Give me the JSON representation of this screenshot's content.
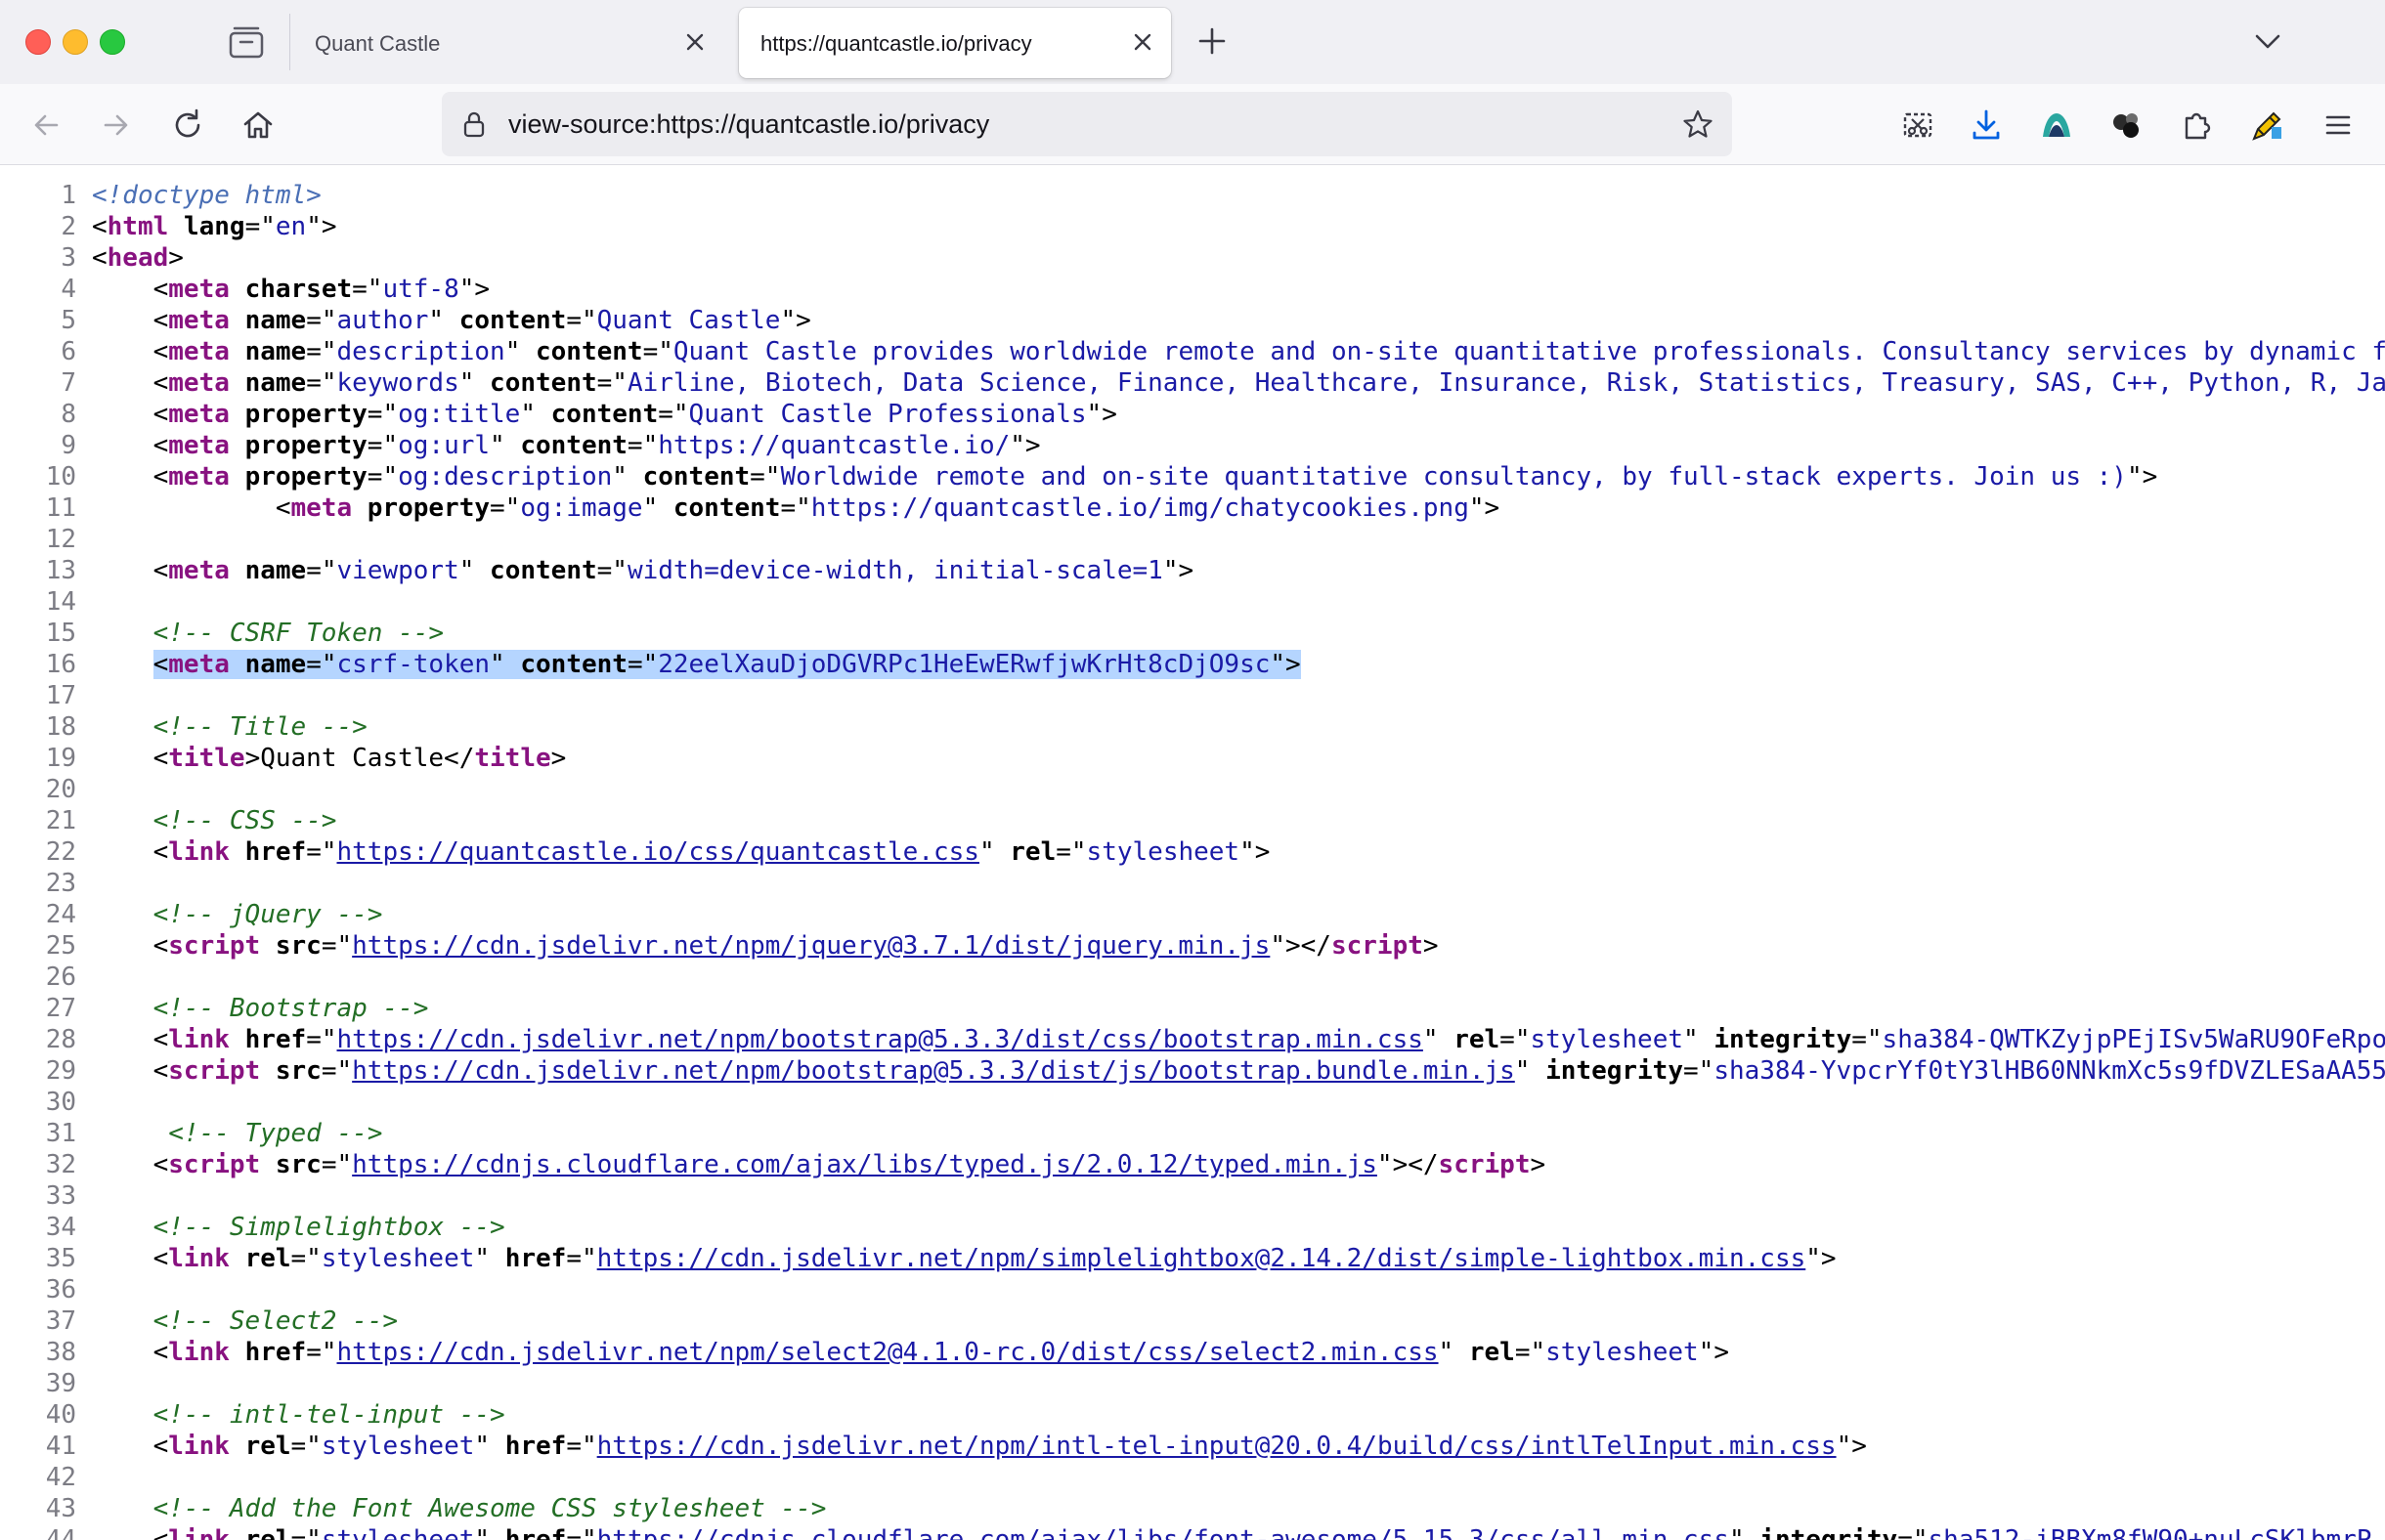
{
  "window": {
    "tabs": [
      {
        "title": "Quant Castle",
        "active": false
      },
      {
        "title": "https://quantcastle.io/privacy",
        "active": true
      }
    ]
  },
  "navbar": {
    "url": "view-source:https://quantcastle.io/privacy"
  },
  "icons": {
    "close": "close-icon",
    "new_tab": "plus-icon",
    "tab_list": "chevron-down-icon",
    "back": "back-arrow-icon",
    "forward": "forward-arrow-icon",
    "reload": "reload-icon",
    "home": "home-icon",
    "lock": "lock-icon",
    "bookmark": "star-icon",
    "screenshot": "screenshot-icon",
    "downloads": "download-icon",
    "extension_1": "extension-logo-icon",
    "extension_2": "extension-dots-icon",
    "extensions": "puzzle-icon",
    "extension_3": "pencil-extension-icon",
    "menu": "hamburger-menu-icon"
  },
  "source": {
    "lines": [
      {
        "n": "1",
        "tokens": [
          [
            "dt",
            "<!doctype html>"
          ]
        ]
      },
      {
        "n": "2",
        "tokens": [
          [
            "p",
            "<"
          ],
          [
            "tag",
            "html"
          ],
          [
            "p",
            " "
          ],
          [
            "an",
            "lang"
          ],
          [
            "p",
            "=\""
          ],
          [
            "av",
            "en"
          ],
          [
            "p",
            "\">"
          ]
        ]
      },
      {
        "n": "3",
        "tokens": [
          [
            "p",
            "<"
          ],
          [
            "tag",
            "head"
          ],
          [
            "p",
            ">"
          ]
        ]
      },
      {
        "n": "4",
        "tokens": [
          [
            "p",
            "    <"
          ],
          [
            "tag",
            "meta"
          ],
          [
            "p",
            " "
          ],
          [
            "an",
            "charset"
          ],
          [
            "p",
            "=\""
          ],
          [
            "av",
            "utf-8"
          ],
          [
            "p",
            "\">"
          ]
        ]
      },
      {
        "n": "5",
        "tokens": [
          [
            "p",
            "    <"
          ],
          [
            "tag",
            "meta"
          ],
          [
            "p",
            " "
          ],
          [
            "an",
            "name"
          ],
          [
            "p",
            "=\""
          ],
          [
            "av",
            "author"
          ],
          [
            "p",
            "\" "
          ],
          [
            "an",
            "content"
          ],
          [
            "p",
            "=\""
          ],
          [
            "av",
            "Quant Castle"
          ],
          [
            "p",
            "\">"
          ]
        ]
      },
      {
        "n": "6",
        "tokens": [
          [
            "p",
            "    <"
          ],
          [
            "tag",
            "meta"
          ],
          [
            "p",
            " "
          ],
          [
            "an",
            "name"
          ],
          [
            "p",
            "=\""
          ],
          [
            "av",
            "description"
          ],
          [
            "p",
            "\" "
          ],
          [
            "an",
            "content"
          ],
          [
            "p",
            "=\""
          ],
          [
            "av",
            "Quant Castle provides worldwide remote and on-site quantitative professionals. Consultancy services by dynamic f"
          ]
        ]
      },
      {
        "n": "7",
        "tokens": [
          [
            "p",
            "    <"
          ],
          [
            "tag",
            "meta"
          ],
          [
            "p",
            " "
          ],
          [
            "an",
            "name"
          ],
          [
            "p",
            "=\""
          ],
          [
            "av",
            "keywords"
          ],
          [
            "p",
            "\" "
          ],
          [
            "an",
            "content"
          ],
          [
            "p",
            "=\""
          ],
          [
            "av",
            "Airline, Biotech, Data Science, Finance, Healthcare, Insurance, Risk, Statistics, Treasury, SAS, C++, Python, R, Ja"
          ]
        ]
      },
      {
        "n": "8",
        "tokens": [
          [
            "p",
            "    <"
          ],
          [
            "tag",
            "meta"
          ],
          [
            "p",
            " "
          ],
          [
            "an",
            "property"
          ],
          [
            "p",
            "=\""
          ],
          [
            "av",
            "og:title"
          ],
          [
            "p",
            "\" "
          ],
          [
            "an",
            "content"
          ],
          [
            "p",
            "=\""
          ],
          [
            "av",
            "Quant Castle Professionals"
          ],
          [
            "p",
            "\">"
          ]
        ]
      },
      {
        "n": "9",
        "tokens": [
          [
            "p",
            "    <"
          ],
          [
            "tag",
            "meta"
          ],
          [
            "p",
            " "
          ],
          [
            "an",
            "property"
          ],
          [
            "p",
            "=\""
          ],
          [
            "av",
            "og:url"
          ],
          [
            "p",
            "\" "
          ],
          [
            "an",
            "content"
          ],
          [
            "p",
            "=\""
          ],
          [
            "av",
            "https://quantcastle.io/"
          ],
          [
            "p",
            "\">"
          ]
        ]
      },
      {
        "n": "10",
        "tokens": [
          [
            "p",
            "    <"
          ],
          [
            "tag",
            "meta"
          ],
          [
            "p",
            " "
          ],
          [
            "an",
            "property"
          ],
          [
            "p",
            "=\""
          ],
          [
            "av",
            "og:description"
          ],
          [
            "p",
            "\" "
          ],
          [
            "an",
            "content"
          ],
          [
            "p",
            "=\""
          ],
          [
            "av",
            "Worldwide remote and on-site quantitative consultancy, by full-stack experts. Join us :)"
          ],
          [
            "p",
            "\">"
          ]
        ]
      },
      {
        "n": "11",
        "tokens": [
          [
            "p",
            "            <"
          ],
          [
            "tag",
            "meta"
          ],
          [
            "p",
            " "
          ],
          [
            "an",
            "property"
          ],
          [
            "p",
            "=\""
          ],
          [
            "av",
            "og:image"
          ],
          [
            "p",
            "\" "
          ],
          [
            "an",
            "content"
          ],
          [
            "p",
            "=\""
          ],
          [
            "av",
            "https://quantcastle.io/img/chatycookies.png"
          ],
          [
            "p",
            "\">"
          ]
        ]
      },
      {
        "n": "12",
        "tokens": []
      },
      {
        "n": "13",
        "tokens": [
          [
            "p",
            "    <"
          ],
          [
            "tag",
            "meta"
          ],
          [
            "p",
            " "
          ],
          [
            "an",
            "name"
          ],
          [
            "p",
            "=\""
          ],
          [
            "av",
            "viewport"
          ],
          [
            "p",
            "\" "
          ],
          [
            "an",
            "content"
          ],
          [
            "p",
            "=\""
          ],
          [
            "av",
            "width=device-width, initial-scale=1"
          ],
          [
            "p",
            "\">"
          ]
        ]
      },
      {
        "n": "14",
        "tokens": []
      },
      {
        "n": "15",
        "tokens": [
          [
            "p",
            "    "
          ],
          [
            "cm",
            "<!-- CSRF Token -->"
          ]
        ]
      },
      {
        "n": "16",
        "selected": true,
        "tokens": [
          [
            "p",
            "    "
          ],
          [
            "sp",
            "<"
          ],
          [
            "stag",
            "meta"
          ],
          [
            "sp",
            " "
          ],
          [
            "san",
            "name"
          ],
          [
            "sp",
            "=\""
          ],
          [
            "sav",
            "csrf-token"
          ],
          [
            "sp",
            "\" "
          ],
          [
            "san",
            "content"
          ],
          [
            "sp",
            "=\""
          ],
          [
            "sav",
            "22eelXauDjoDGVRPc1HeEwERwfjwKrHt8cDjO9sc"
          ],
          [
            "sp",
            "\">"
          ]
        ]
      },
      {
        "n": "17",
        "tokens": []
      },
      {
        "n": "18",
        "tokens": [
          [
            "p",
            "    "
          ],
          [
            "cm",
            "<!-- Title -->"
          ]
        ]
      },
      {
        "n": "19",
        "tokens": [
          [
            "p",
            "    <"
          ],
          [
            "tag",
            "title"
          ],
          [
            "p",
            ">Quant Castle</"
          ],
          [
            "tag",
            "title"
          ],
          [
            "p",
            ">"
          ]
        ]
      },
      {
        "n": "20",
        "tokens": []
      },
      {
        "n": "21",
        "tokens": [
          [
            "p",
            "    "
          ],
          [
            "cm",
            "<!-- CSS -->"
          ]
        ]
      },
      {
        "n": "22",
        "tokens": [
          [
            "p",
            "    <"
          ],
          [
            "tag",
            "link"
          ],
          [
            "p",
            " "
          ],
          [
            "an",
            "href"
          ],
          [
            "p",
            "=\""
          ],
          [
            "lk",
            "https://quantcastle.io/css/quantcastle.css"
          ],
          [
            "p",
            "\" "
          ],
          [
            "an",
            "rel"
          ],
          [
            "p",
            "=\""
          ],
          [
            "av",
            "stylesheet"
          ],
          [
            "p",
            "\">"
          ]
        ]
      },
      {
        "n": "23",
        "tokens": []
      },
      {
        "n": "24",
        "tokens": [
          [
            "p",
            "    "
          ],
          [
            "cm",
            "<!-- jQuery -->"
          ]
        ]
      },
      {
        "n": "25",
        "tokens": [
          [
            "p",
            "    <"
          ],
          [
            "tag",
            "script"
          ],
          [
            "p",
            " "
          ],
          [
            "an",
            "src"
          ],
          [
            "p",
            "=\""
          ],
          [
            "lk",
            "https://cdn.jsdelivr.net/npm/jquery@3.7.1/dist/jquery.min.js"
          ],
          [
            "p",
            "\"></"
          ],
          [
            "tag",
            "script"
          ],
          [
            "p",
            ">"
          ]
        ]
      },
      {
        "n": "26",
        "tokens": []
      },
      {
        "n": "27",
        "tokens": [
          [
            "p",
            "    "
          ],
          [
            "cm",
            "<!-- Bootstrap -->"
          ]
        ]
      },
      {
        "n": "28",
        "tokens": [
          [
            "p",
            "    <"
          ],
          [
            "tag",
            "link"
          ],
          [
            "p",
            " "
          ],
          [
            "an",
            "href"
          ],
          [
            "p",
            "=\""
          ],
          [
            "lk",
            "https://cdn.jsdelivr.net/npm/bootstrap@5.3.3/dist/css/bootstrap.min.css"
          ],
          [
            "p",
            "\" "
          ],
          [
            "an",
            "rel"
          ],
          [
            "p",
            "=\""
          ],
          [
            "av",
            "stylesheet"
          ],
          [
            "p",
            "\" "
          ],
          [
            "an",
            "integrity"
          ],
          [
            "p",
            "=\""
          ],
          [
            "av",
            "sha384-QWTKZyjpPEjISv5WaRU9OFeRpo"
          ]
        ]
      },
      {
        "n": "29",
        "tokens": [
          [
            "p",
            "    <"
          ],
          [
            "tag",
            "script"
          ],
          [
            "p",
            " "
          ],
          [
            "an",
            "src"
          ],
          [
            "p",
            "=\""
          ],
          [
            "lk",
            "https://cdn.jsdelivr.net/npm/bootstrap@5.3.3/dist/js/bootstrap.bundle.min.js"
          ],
          [
            "p",
            "\" "
          ],
          [
            "an",
            "integrity"
          ],
          [
            "p",
            "=\""
          ],
          [
            "av",
            "sha384-YvpcrYf0tY3lHB60NNkmXc5s9fDVZLESaAA55"
          ]
        ]
      },
      {
        "n": "30",
        "tokens": []
      },
      {
        "n": "31",
        "tokens": [
          [
            "p",
            "     "
          ],
          [
            "cm",
            "<!-- Typed -->"
          ]
        ]
      },
      {
        "n": "32",
        "tokens": [
          [
            "p",
            "    <"
          ],
          [
            "tag",
            "script"
          ],
          [
            "p",
            " "
          ],
          [
            "an",
            "src"
          ],
          [
            "p",
            "=\""
          ],
          [
            "lk",
            "https://cdnjs.cloudflare.com/ajax/libs/typed.js/2.0.12/typed.min.js"
          ],
          [
            "p",
            "\"></"
          ],
          [
            "tag",
            "script"
          ],
          [
            "p",
            ">"
          ]
        ]
      },
      {
        "n": "33",
        "tokens": []
      },
      {
        "n": "34",
        "tokens": [
          [
            "p",
            "    "
          ],
          [
            "cm",
            "<!-- Simplelightbox -->"
          ]
        ]
      },
      {
        "n": "35",
        "tokens": [
          [
            "p",
            "    <"
          ],
          [
            "tag",
            "link"
          ],
          [
            "p",
            " "
          ],
          [
            "an",
            "rel"
          ],
          [
            "p",
            "=\""
          ],
          [
            "av",
            "stylesheet"
          ],
          [
            "p",
            "\" "
          ],
          [
            "an",
            "href"
          ],
          [
            "p",
            "=\""
          ],
          [
            "lk",
            "https://cdn.jsdelivr.net/npm/simplelightbox@2.14.2/dist/simple-lightbox.min.css"
          ],
          [
            "p",
            "\">"
          ]
        ]
      },
      {
        "n": "36",
        "tokens": []
      },
      {
        "n": "37",
        "tokens": [
          [
            "p",
            "    "
          ],
          [
            "cm",
            "<!-- Select2 -->"
          ]
        ]
      },
      {
        "n": "38",
        "tokens": [
          [
            "p",
            "    <"
          ],
          [
            "tag",
            "link"
          ],
          [
            "p",
            " "
          ],
          [
            "an",
            "href"
          ],
          [
            "p",
            "=\""
          ],
          [
            "lk",
            "https://cdn.jsdelivr.net/npm/select2@4.1.0-rc.0/dist/css/select2.min.css"
          ],
          [
            "p",
            "\" "
          ],
          [
            "an",
            "rel"
          ],
          [
            "p",
            "=\""
          ],
          [
            "av",
            "stylesheet"
          ],
          [
            "p",
            "\">"
          ]
        ]
      },
      {
        "n": "39",
        "tokens": []
      },
      {
        "n": "40",
        "tokens": [
          [
            "p",
            "    "
          ],
          [
            "cm",
            "<!-- intl-tel-input -->"
          ]
        ]
      },
      {
        "n": "41",
        "tokens": [
          [
            "p",
            "    <"
          ],
          [
            "tag",
            "link"
          ],
          [
            "p",
            " "
          ],
          [
            "an",
            "rel"
          ],
          [
            "p",
            "=\""
          ],
          [
            "av",
            "stylesheet"
          ],
          [
            "p",
            "\" "
          ],
          [
            "an",
            "href"
          ],
          [
            "p",
            "=\""
          ],
          [
            "lk",
            "https://cdn.jsdelivr.net/npm/intl-tel-input@20.0.4/build/css/intlTelInput.min.css"
          ],
          [
            "p",
            "\">"
          ]
        ]
      },
      {
        "n": "42",
        "tokens": []
      },
      {
        "n": "43",
        "tokens": [
          [
            "p",
            "    "
          ],
          [
            "cm",
            "<!-- Add the Font Awesome CSS stylesheet -->"
          ]
        ]
      },
      {
        "n": "44",
        "tokens": [
          [
            "p",
            "    <"
          ],
          [
            "tag",
            "link"
          ],
          [
            "p",
            " "
          ],
          [
            "an",
            "rel"
          ],
          [
            "p",
            "=\""
          ],
          [
            "av",
            "stylesheet"
          ],
          [
            "p",
            "\" "
          ],
          [
            "an",
            "href"
          ],
          [
            "p",
            "=\""
          ],
          [
            "lk",
            "https://cdnjs.cloudflare.com/ajax/libs/font-awesome/5.15.3/css/all.min.css"
          ],
          [
            "p",
            "\" "
          ],
          [
            "an",
            "integrity"
          ],
          [
            "p",
            "=\""
          ],
          [
            "av",
            "sha512-iBBXm8fW90+nuLcSKlbmrP"
          ]
        ]
      }
    ]
  }
}
